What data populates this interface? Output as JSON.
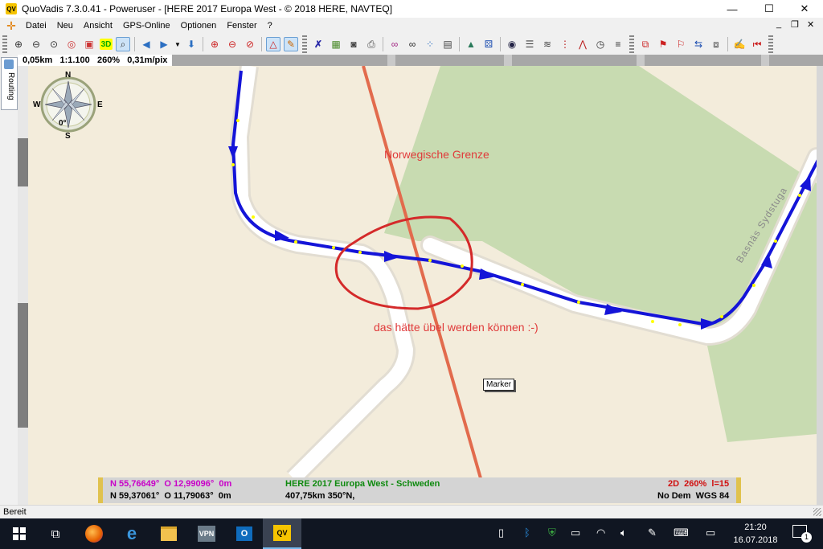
{
  "window": {
    "title": "QuoVadis 7.3.0.41 - Poweruser - [HERE 2017 Europa West - © 2018 HERE, NAVTEQ]",
    "app_icon_text": "QV",
    "minimize": "—",
    "maximize": "☐",
    "close": "✕"
  },
  "menu": {
    "items": [
      "Datei",
      "Neu",
      "Ansicht",
      "GPS-Online",
      "Optionen",
      "Fenster",
      "?"
    ],
    "mdi_minimize": "_",
    "mdi_restore": "❐",
    "mdi_close": "✕"
  },
  "toolbar": {
    "three_d_label": "3D"
  },
  "scalebar": {
    "text": "0,05km   1:1.100   260%   0,31m/pix"
  },
  "sidebar": {
    "routing_label": "Routing"
  },
  "map": {
    "compass": {
      "n": "N",
      "s": "S",
      "e": "E",
      "w": "W",
      "heading": "0°"
    },
    "border_label": "Norwegische Grenze",
    "comment_label": "das hätte übel werden können :-)",
    "marker_label": "Marker",
    "road_label": "Basnäs Sydstuga",
    "colors": {
      "land": "#f3ecdb",
      "forest": "#c8dbb1",
      "road": "#ffffff",
      "road_casing": "#e2ddd2",
      "border": "#e26b4d",
      "route": "#1414d8",
      "circle": "#d42a2a"
    }
  },
  "gps_panel": {
    "pos1": "N 55,76649°  O 12,99096°  0m",
    "pos2": "N 59,37061°  O 11,79063°  0m",
    "map_info": "HERE 2017 Europa West - Schweden",
    "distance": "407,75km 350°N,",
    "mode": "2D  260%  l=15",
    "datum": "No Dem  WGS 84",
    "colors": {
      "pos1": "#c800c8",
      "map_info": "#0f8a0f",
      "mode": "#d01010"
    }
  },
  "statusbar": {
    "text": "Bereit"
  },
  "taskbar": {
    "clock_time": "21:20",
    "clock_date": "16.07.2018",
    "vpn_label": "VPN",
    "notification_count": "1"
  }
}
